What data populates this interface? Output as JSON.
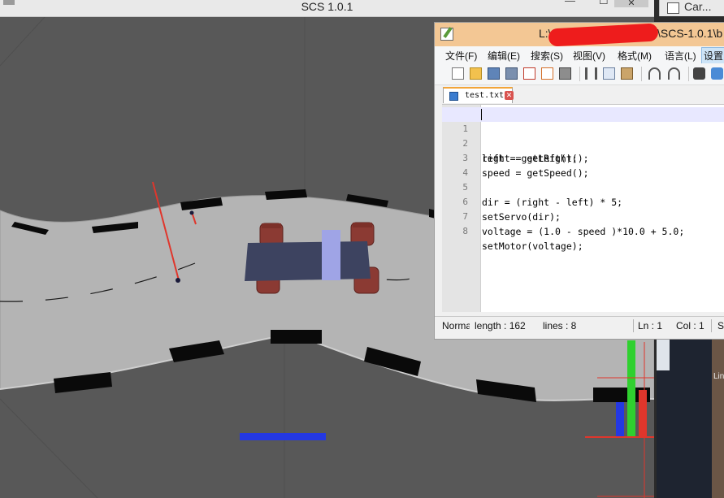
{
  "main_window": {
    "title": "SCS 1.0.1",
    "controls": {
      "minimize": "—",
      "maximize": "☐",
      "close": "✕"
    }
  },
  "second_window": {
    "title": "Car..."
  },
  "strip": {
    "text": "Lin"
  },
  "editor": {
    "title_left": "L:\\",
    "title_right": "\\SCS-1.0.1\\b",
    "menu": [
      "文件(F)",
      "编辑(E)",
      "搜索(S)",
      "视图(V)",
      "格式(M)",
      "语言(L)",
      "设置"
    ],
    "toolbar_icons": [
      "new-file-icon",
      "open-file-icon",
      "save-icon",
      "save-all-icon",
      "close-icon",
      "close-all-icon",
      "print-icon",
      "cut-icon",
      "copy-icon",
      "paste-icon",
      "undo-icon",
      "redo-icon",
      "find-icon",
      "replace-icon"
    ],
    "tab": {
      "label": "test.txt",
      "close": "✕"
    },
    "lines": [
      {
        "n": "1",
        "code": "left = getLeft();"
      },
      {
        "n": "2",
        "code": "right = getRight();"
      },
      {
        "n": "3",
        "code": "speed = getSpeed();"
      },
      {
        "n": "4",
        "code": ""
      },
      {
        "n": "5",
        "code": "dir = (right - left) * 5;"
      },
      {
        "n": "6",
        "code": "setServo(dir);"
      },
      {
        "n": "7",
        "code": "voltage = (1.0 - speed )*10.0 + 5.0;"
      },
      {
        "n": "8",
        "code": "setMotor(voltage);"
      }
    ],
    "status": {
      "type": "Norma",
      "length": "length : 162",
      "lines": "lines : 8",
      "ln": "Ln : 1",
      "col": "Col : 1",
      "sel": "S"
    }
  },
  "colors": {
    "ground": "#585858",
    "road": "#b4b4b4",
    "car_body": "#3d4360",
    "car_stripe": "#9fa4e6",
    "wheel": "#8b3a33",
    "axis_red": "#e0362c",
    "axis_green": "#2fd02f",
    "axis_blue": "#2438e2",
    "editor_title": "#f3c794"
  }
}
